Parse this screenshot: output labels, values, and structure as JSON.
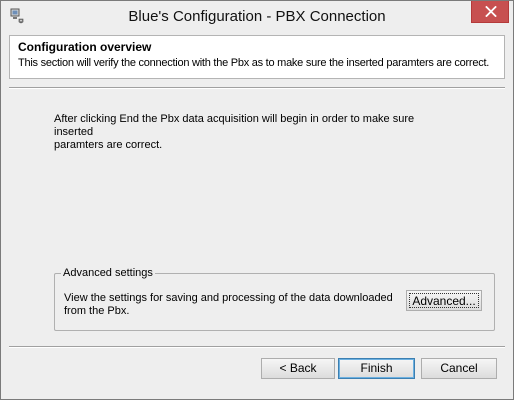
{
  "window": {
    "title": "Blue's Configuration - PBX Connection",
    "icon": "app-icon",
    "close_icon": "close-icon"
  },
  "header": {
    "title": "Configuration overview",
    "description": "This section will verify the connection with the Pbx as to make sure the inserted paramters are correct."
  },
  "main": {
    "text": "After clicking End the Pbx data acquisition will begin in order to make sure inserted\nparamters  are correct."
  },
  "advanced_group": {
    "legend": "Advanced settings",
    "description": "View the settings for saving and processing of the data downloaded\nfrom the Pbx.",
    "button_label": "Advanced..."
  },
  "footer": {
    "back_label": "< Back",
    "finish_label": "Finish",
    "cancel_label": "Cancel"
  },
  "colors": {
    "close_button": "#c75050",
    "window_bg": "#eeeeee",
    "panel_bg": "#ffffff"
  }
}
